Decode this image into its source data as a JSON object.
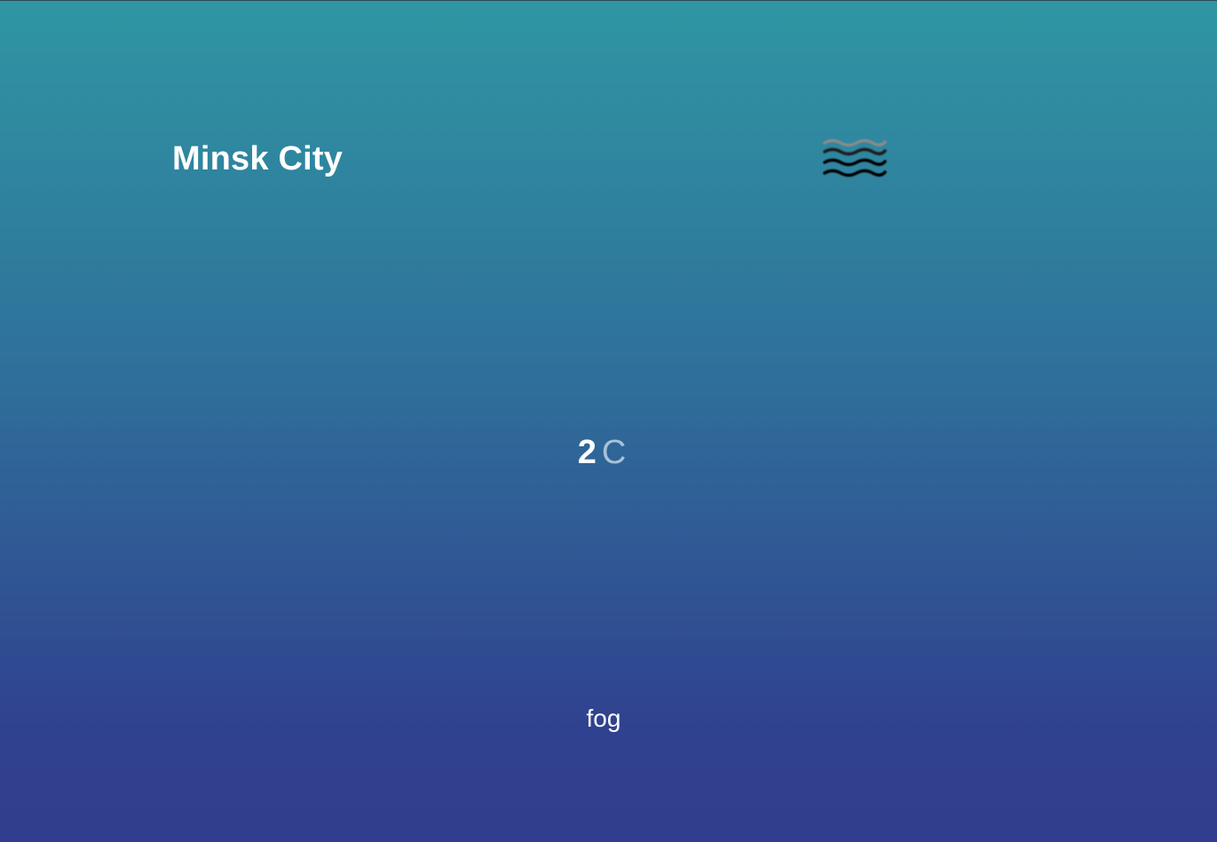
{
  "location": {
    "city": "Minsk City"
  },
  "current": {
    "temperature": "2",
    "unit": "C",
    "condition": "fog",
    "icon": "fog-icon"
  },
  "colors": {
    "gradient_top": "#2f96a3",
    "gradient_bottom": "#313d8e",
    "text": "#ffffff",
    "unit_text": "#a9c2d6"
  }
}
